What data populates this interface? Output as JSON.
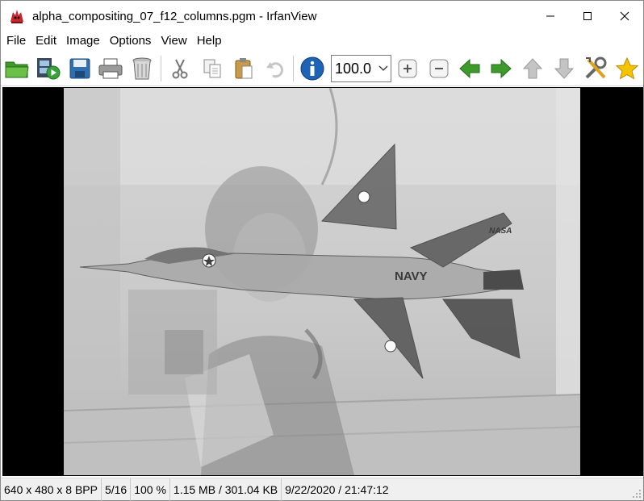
{
  "window": {
    "title": "alpha_compositing_07_f12_columns.pgm - IrfanView",
    "app_icon": "irfanview-red-cat-icon",
    "controls": [
      "minimize-icon",
      "maximize-icon",
      "close-icon"
    ]
  },
  "menu": {
    "items": [
      {
        "label": "File"
      },
      {
        "label": "Edit"
      },
      {
        "label": "Image"
      },
      {
        "label": "Options"
      },
      {
        "label": "View"
      },
      {
        "label": "Help"
      }
    ]
  },
  "toolbar": {
    "buttons": [
      {
        "icon": "open-folder-icon"
      },
      {
        "icon": "slideshow-icon"
      },
      {
        "icon": "save-icon"
      },
      {
        "icon": "print-icon"
      },
      {
        "icon": "delete-icon"
      },
      {
        "icon": "cut-icon"
      },
      {
        "icon": "copy-icon"
      },
      {
        "icon": "paste-icon"
      },
      {
        "icon": "undo-icon"
      },
      {
        "icon": "info-icon"
      },
      {
        "icon": "zoom-in-icon"
      },
      {
        "icon": "zoom-out-icon"
      },
      {
        "icon": "previous-arrow-icon"
      },
      {
        "icon": "next-arrow-icon"
      },
      {
        "icon": "up-arrow-icon"
      },
      {
        "icon": "down-arrow-icon"
      },
      {
        "icon": "properties-tools-icon"
      },
      {
        "icon": "favorites-star-icon"
      }
    ],
    "zoom_value": "100.0"
  },
  "image": {
    "content": "grayscale alpha composite of a woman and an F-14 jet labeled NAVY / NASA",
    "jet_labels": [
      "NAVY",
      "NASA"
    ]
  },
  "statusbar": {
    "dimensions": "640 x 480 x 8 BPP",
    "index": "5/16",
    "zoom": "100 %",
    "size": "1.15 MB / 301.04 KB",
    "datetime": "9/22/2020 / 21:47:12"
  },
  "colors": {
    "accent_green": "#3e9a2c",
    "info_blue": "#1e63b5",
    "star_yellow": "#f5c400",
    "viewport_bg": "#000000",
    "statusbar_bg": "#f0f0f0"
  }
}
